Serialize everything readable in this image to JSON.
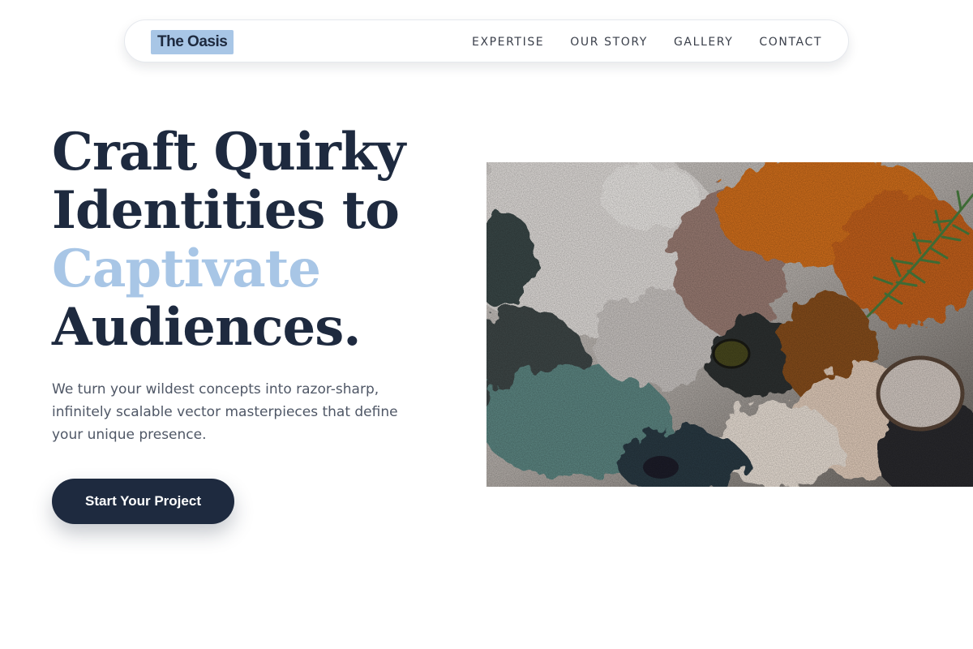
{
  "nav": {
    "logo": "The Oasis",
    "links": [
      "EXPERTISE",
      "OUR STORY",
      "GALLERY",
      "CONTACT"
    ]
  },
  "hero": {
    "headline": {
      "line1": "Craft Quirky",
      "line2": "Identities to",
      "line3_accent": "Captivate",
      "line4": "Audiences."
    },
    "subtitle": "We turn your wildest concepts into razor-sharp, infinitely scalable vector masterpieces that define your unique presence.",
    "cta_label": "Start Your Project",
    "image": {
      "subject": "textured oil paint palette with rosemary sprig"
    }
  },
  "colors": {
    "primary_navy": "#1e2a3f",
    "accent_blue": "#a8c6e6",
    "body_text": "#4f5766",
    "paint_orange": "#d8721a",
    "paint_teal": "#5f8a86"
  }
}
